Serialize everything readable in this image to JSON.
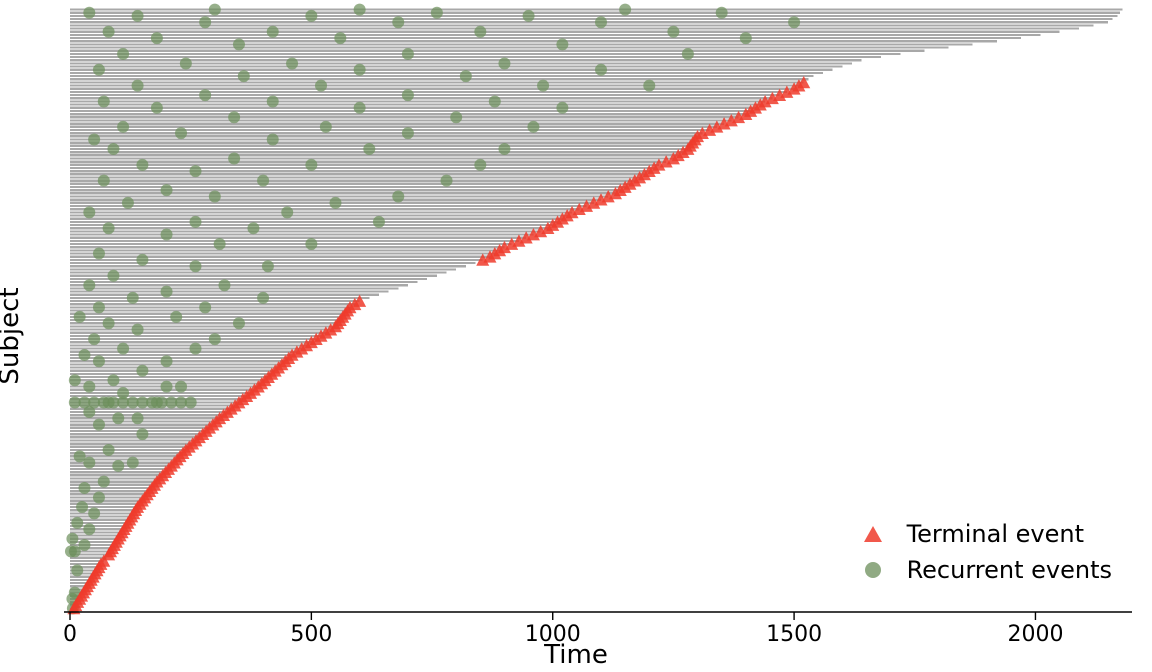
{
  "chart_data": {
    "type": "scatter",
    "title": "",
    "xlabel": "Time",
    "ylabel": "Subject",
    "xlim": [
      0,
      2200
    ],
    "xticks": [
      0,
      500,
      1000,
      1500,
      2000
    ],
    "legend": {
      "position": "lower right",
      "entries": [
        {
          "name": "Terminal event",
          "marker": "triangle",
          "color": "#ef3b2c"
        },
        {
          "name": "Recurrent events",
          "marker": "circle",
          "color": "#6b8e5a"
        }
      ]
    },
    "followup": [
      8,
      12,
      16,
      20,
      24,
      28,
      32,
      36,
      40,
      44,
      48,
      52,
      56,
      60,
      64,
      70,
      76,
      80,
      84,
      88,
      92,
      96,
      100,
      104,
      108,
      112,
      116,
      120,
      124,
      128,
      132,
      136,
      140,
      145,
      150,
      155,
      160,
      165,
      170,
      175,
      180,
      186,
      192,
      198,
      204,
      210,
      216,
      222,
      228,
      234,
      240,
      247,
      254,
      261,
      268,
      275,
      282,
      289,
      296,
      303,
      310,
      318,
      326,
      334,
      342,
      350,
      358,
      366,
      374,
      382,
      390,
      397,
      404,
      411,
      418,
      425,
      432,
      439,
      446,
      453,
      460,
      470,
      480,
      490,
      500,
      510,
      520,
      530,
      540,
      550,
      555,
      560,
      565,
      570,
      575,
      580,
      590,
      600,
      620,
      640,
      660,
      680,
      700,
      720,
      740,
      760,
      780,
      800,
      820,
      840,
      855,
      870,
      880,
      890,
      900,
      915,
      930,
      945,
      960,
      975,
      990,
      1000,
      1010,
      1020,
      1030,
      1040,
      1055,
      1070,
      1085,
      1100,
      1115,
      1130,
      1140,
      1150,
      1160,
      1170,
      1180,
      1190,
      1200,
      1210,
      1220,
      1235,
      1250,
      1260,
      1270,
      1280,
      1285,
      1290,
      1295,
      1300,
      1310,
      1325,
      1340,
      1355,
      1370,
      1385,
      1400,
      1410,
      1420,
      1430,
      1440,
      1455,
      1470,
      1485,
      1500,
      1510,
      1520,
      1530,
      1540,
      1560,
      1580,
      1600,
      1620,
      1640,
      1680,
      1720,
      1770,
      1820,
      1870,
      1920,
      1970,
      2010,
      2050,
      2090,
      2120,
      2150,
      2160,
      2170,
      2175,
      2180
    ],
    "terminal": [
      0,
      1,
      2,
      3,
      4,
      5,
      6,
      7,
      8,
      9,
      10,
      11,
      12,
      13,
      14,
      15,
      17,
      18,
      19,
      20,
      21,
      22,
      23,
      24,
      25,
      26,
      27,
      28,
      29,
      30,
      31,
      32,
      33,
      34,
      35,
      36,
      37,
      38,
      39,
      40,
      41,
      42,
      43,
      44,
      45,
      46,
      47,
      48,
      49,
      50,
      51,
      52,
      53,
      54,
      55,
      56,
      57,
      58,
      59,
      60,
      61,
      62,
      63,
      64,
      65,
      66,
      67,
      68,
      69,
      70,
      71,
      72,
      73,
      74,
      75,
      76,
      77,
      78,
      79,
      80,
      81,
      82,
      83,
      84,
      85,
      86,
      87,
      88,
      89,
      90,
      91,
      92,
      93,
      94,
      95,
      96,
      97,
      110,
      111,
      112,
      113,
      114,
      115,
      116,
      117,
      118,
      119,
      120,
      121,
      122,
      123,
      124,
      125,
      126,
      127,
      128,
      129,
      130,
      131,
      132,
      133,
      134,
      135,
      136,
      137,
      138,
      139,
      140,
      141,
      142,
      143,
      144,
      145,
      146,
      147,
      148,
      149,
      150,
      151,
      152,
      153,
      154,
      155,
      156,
      157,
      158,
      159,
      160,
      161,
      162,
      163,
      164,
      165,
      166
    ],
    "recurrent": [
      [
        3,
        5
      ],
      [
        0,
        6
      ],
      [
        5,
        10
      ],
      [
        12,
        15
      ],
      [
        18,
        2
      ],
      [
        18,
        10
      ],
      [
        20,
        30
      ],
      [
        22,
        5
      ],
      [
        25,
        40
      ],
      [
        27,
        15
      ],
      [
        30,
        50
      ],
      [
        32,
        25
      ],
      [
        35,
        60
      ],
      [
        38,
        30
      ],
      [
        40,
        70
      ],
      [
        45,
        100
      ],
      [
        46,
        130
      ],
      [
        46,
        40
      ],
      [
        48,
        20
      ],
      [
        50,
        80
      ],
      [
        55,
        150
      ],
      [
        58,
        60
      ],
      [
        60,
        100
      ],
      [
        60,
        140
      ],
      [
        62,
        40
      ],
      [
        65,
        80
      ],
      [
        65,
        180
      ],
      [
        68,
        110
      ],
      [
        70,
        40
      ],
      [
        70,
        200
      ],
      [
        70,
        230
      ],
      [
        72,
        10
      ],
      [
        72,
        90
      ],
      [
        75,
        150
      ],
      [
        78,
        60
      ],
      [
        78,
        200
      ],
      [
        80,
        30
      ],
      [
        82,
        110
      ],
      [
        82,
        260
      ],
      [
        85,
        50
      ],
      [
        85,
        300
      ],
      [
        88,
        140
      ],
      [
        90,
        80
      ],
      [
        90,
        350
      ],
      [
        92,
        220
      ],
      [
        92,
        20
      ],
      [
        95,
        60
      ],
      [
        95,
        280
      ],
      [
        98,
        130
      ],
      [
        98,
        400
      ],
      [
        100,
        200
      ],
      [
        102,
        40
      ],
      [
        102,
        320
      ],
      [
        105,
        90
      ],
      [
        108,
        260
      ],
      [
        108,
        410
      ],
      [
        110,
        150
      ],
      [
        112,
        60
      ],
      [
        115,
        310
      ],
      [
        115,
        500
      ],
      [
        118,
        200
      ],
      [
        120,
        80
      ],
      [
        120,
        380
      ],
      [
        122,
        260
      ],
      [
        122,
        640
      ],
      [
        125,
        40
      ],
      [
        125,
        450
      ],
      [
        128,
        120
      ],
      [
        128,
        550
      ],
      [
        130,
        300
      ],
      [
        130,
        680
      ],
      [
        132,
        200
      ],
      [
        135,
        70
      ],
      [
        135,
        400
      ],
      [
        135,
        780
      ],
      [
        138,
        260
      ],
      [
        140,
        150
      ],
      [
        140,
        500
      ],
      [
        140,
        850
      ],
      [
        142,
        340
      ],
      [
        145,
        90
      ],
      [
        145,
        620
      ],
      [
        145,
        900
      ],
      [
        148,
        420
      ],
      [
        148,
        50
      ],
      [
        150,
        230
      ],
      [
        150,
        700
      ],
      [
        152,
        110
      ],
      [
        152,
        530
      ],
      [
        152,
        960
      ],
      [
        155,
        340
      ],
      [
        155,
        800
      ],
      [
        158,
        180
      ],
      [
        158,
        600
      ],
      [
        158,
        1020
      ],
      [
        160,
        70
      ],
      [
        160,
        420
      ],
      [
        160,
        880
      ],
      [
        162,
        280
      ],
      [
        162,
        700
      ],
      [
        165,
        140
      ],
      [
        165,
        520
      ],
      [
        165,
        980
      ],
      [
        165,
        1200
      ],
      [
        168,
        360
      ],
      [
        168,
        820
      ],
      [
        170,
        60
      ],
      [
        170,
        600
      ],
      [
        170,
        1100
      ],
      [
        172,
        240
      ],
      [
        172,
        460
      ],
      [
        172,
        900
      ],
      [
        175,
        110
      ],
      [
        175,
        700
      ],
      [
        175,
        1280
      ],
      [
        178,
        350
      ],
      [
        178,
        1020
      ],
      [
        180,
        180
      ],
      [
        180,
        560
      ],
      [
        180,
        1400
      ],
      [
        182,
        80
      ],
      [
        182,
        420
      ],
      [
        182,
        850
      ],
      [
        182,
        1250
      ],
      [
        185,
        280
      ],
      [
        185,
        680
      ],
      [
        185,
        1100
      ],
      [
        185,
        1500
      ],
      [
        187,
        140
      ],
      [
        187,
        500
      ],
      [
        187,
        950
      ],
      [
        188,
        40
      ],
      [
        188,
        760
      ],
      [
        188,
        1350
      ],
      [
        189,
        300
      ],
      [
        189,
        600
      ],
      [
        189,
        1150
      ],
      [
        65,
        10
      ],
      [
        65,
        30
      ],
      [
        65,
        50
      ],
      [
        65,
        70
      ],
      [
        65,
        90
      ],
      [
        65,
        110
      ],
      [
        65,
        130
      ],
      [
        65,
        150
      ],
      [
        65,
        170
      ],
      [
        65,
        190
      ],
      [
        65,
        210
      ],
      [
        65,
        230
      ],
      [
        65,
        250
      ]
    ],
    "colors": {
      "bar": "#a8a8a8",
      "terminal": "#ef3b2c",
      "recurrent": "#6b8e5a",
      "axis": "#000000"
    }
  }
}
